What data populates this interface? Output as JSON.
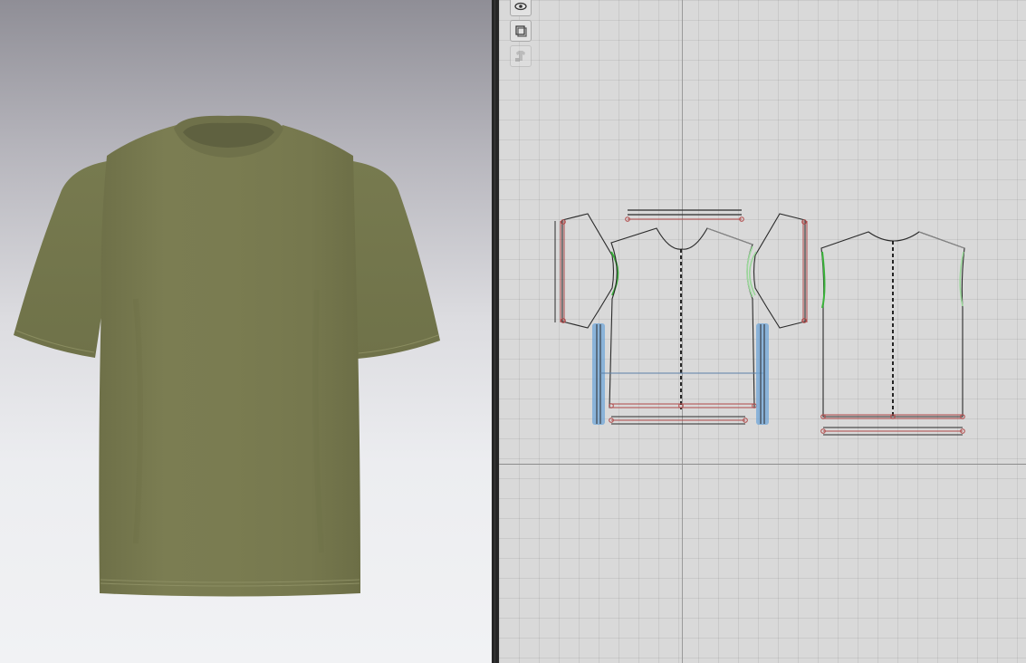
{
  "app": {
    "name": ""
  },
  "viewport3d": {
    "garment": "t-shirt",
    "garment_color": "#7a7c52",
    "background_top": "#8f8e96",
    "background_bottom": "#f1f2f4"
  },
  "viewport2d": {
    "grid_color": "#d9d9d9",
    "toolbar": [
      {
        "icon": "eye-icon",
        "state": "active"
      },
      {
        "icon": "layers-icon",
        "state": "active"
      },
      {
        "icon": "locked-garment-icon",
        "state": "disabled"
      }
    ],
    "pieces": [
      {
        "name": "front-neck-binding"
      },
      {
        "name": "left-sleeve"
      },
      {
        "name": "left-sleeve-hem-band"
      },
      {
        "name": "front-body"
      },
      {
        "name": "front-hem-band"
      },
      {
        "name": "right-sleeve"
      },
      {
        "name": "right-sleeve-hem-band"
      },
      {
        "name": "back-body"
      },
      {
        "name": "back-hem-band"
      }
    ],
    "colors": {
      "outline": "#2a2a2a",
      "sewing_line": "#b04848",
      "armhole_seam": "#3bb43b",
      "selection": "#6fa6d8"
    }
  }
}
